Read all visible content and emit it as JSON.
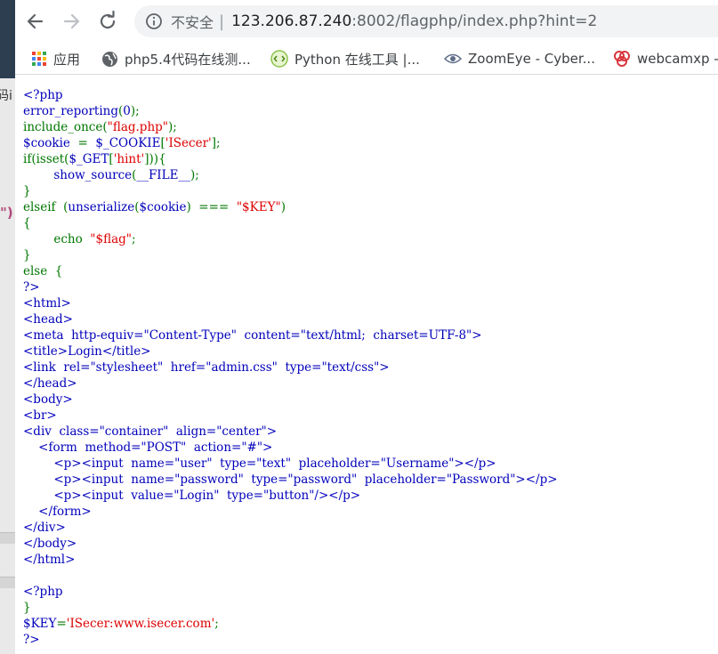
{
  "toolbar": {
    "back_icon": "back-arrow-icon",
    "forward_icon": "forward-arrow-icon",
    "reload_icon": "reload-icon",
    "security_icon": "info-icon",
    "security_label": "不安全",
    "separator": "|",
    "url_host": "123.206.87.240",
    "url_rest": ":8002/flagphp/index.php?hint=2"
  },
  "bookmarks": [
    {
      "icon": "apps-grid-icon",
      "label": "应用"
    },
    {
      "icon": "globe-icon",
      "label": "php5.4代码在线测..."
    },
    {
      "icon": "python-tool-icon",
      "label": "Python 在线工具 |..."
    },
    {
      "icon": "eye-icon",
      "label": "ZoomEye - Cyber..."
    },
    {
      "icon": "webcam-icon",
      "label": "webcamxp -"
    }
  ],
  "left_window": {
    "fragment_text": "码i",
    "quote_fragment": "\")"
  },
  "source_lines": [
    [
      [
        "c-blue",
        "<?php"
      ]
    ],
    [
      [
        "c-blue",
        "error_reporting"
      ],
      [
        "c-green",
        "("
      ],
      [
        "c-blue",
        "0"
      ],
      [
        "c-green",
        ");"
      ]
    ],
    [
      [
        "c-green",
        "include_once("
      ],
      [
        "c-red",
        "\"flag.php\""
      ],
      [
        "c-green",
        ");"
      ]
    ],
    [
      [
        "c-blue",
        "$cookie  "
      ],
      [
        "c-green",
        "=  "
      ],
      [
        "c-blue",
        "$_COOKIE"
      ],
      [
        "c-green",
        "["
      ],
      [
        "c-red",
        "'ISecer'"
      ],
      [
        "c-green",
        "];"
      ]
    ],
    [
      [
        "c-green",
        "if(isset("
      ],
      [
        "c-blue",
        "$_GET"
      ],
      [
        "c-green",
        "["
      ],
      [
        "c-red",
        "'hint'"
      ],
      [
        "c-green",
        "])){"
      ]
    ],
    [
      [
        "c-green",
        "        "
      ],
      [
        "c-blue",
        "show_source"
      ],
      [
        "c-green",
        "("
      ],
      [
        "c-blue",
        "__FILE__"
      ],
      [
        "c-green",
        ");"
      ]
    ],
    [
      [
        "c-green",
        "}"
      ]
    ],
    [
      [
        "c-green",
        "elseif  ("
      ],
      [
        "c-blue",
        "unserialize"
      ],
      [
        "c-green",
        "("
      ],
      [
        "c-blue",
        "$cookie"
      ],
      [
        "c-green",
        ")  ===  "
      ],
      [
        "c-red",
        "\"$KEY\""
      ],
      [
        "c-green",
        ")"
      ]
    ],
    [
      [
        "c-green",
        "{"
      ]
    ],
    [
      [
        "c-green",
        "        echo  "
      ],
      [
        "c-red",
        "\"$flag\""
      ],
      [
        "c-green",
        ";"
      ]
    ],
    [
      [
        "c-green",
        "}"
      ]
    ],
    [
      [
        "c-green",
        "else  {"
      ]
    ],
    [
      [
        "c-blue",
        "?>"
      ]
    ],
    [
      [
        "c-blue",
        "<html>"
      ]
    ],
    [
      [
        "c-blue",
        "<head>"
      ]
    ],
    [
      [
        "c-blue",
        "<meta  http-equiv=\"Content-Type\"  content=\"text/html;  charset=UTF-8\">"
      ]
    ],
    [
      [
        "c-blue",
        "<title>Login</title>"
      ]
    ],
    [
      [
        "c-blue",
        "<link  rel=\"stylesheet\"  href=\"admin.css\"  type=\"text/css\">"
      ]
    ],
    [
      [
        "c-blue",
        "</head>"
      ]
    ],
    [
      [
        "c-blue",
        "<body>"
      ]
    ],
    [
      [
        "c-blue",
        "<br>"
      ]
    ],
    [
      [
        "c-blue",
        "<div  class=\"container\"  align=\"center\">"
      ]
    ],
    [
      [
        "c-blue",
        "    <form  method=\"POST\"  action=\"#\">"
      ]
    ],
    [
      [
        "c-blue",
        "        <p><input  name=\"user\"  type=\"text\"  placeholder=\"Username\"></p>"
      ]
    ],
    [
      [
        "c-blue",
        "        <p><input  name=\"password\"  type=\"password\"  placeholder=\"Password\"></p>"
      ]
    ],
    [
      [
        "c-blue",
        "        <p><input  value=\"Login\"  type=\"button\"/></p>"
      ]
    ],
    [
      [
        "c-blue",
        "    </form>"
      ]
    ],
    [
      [
        "c-blue",
        "</div>"
      ]
    ],
    [
      [
        "c-blue",
        "</body>"
      ]
    ],
    [
      [
        "c-blue",
        "</html>"
      ]
    ],
    [
      [
        "c-blue",
        ""
      ]
    ],
    [
      [
        "c-blue",
        "<?php"
      ]
    ],
    [
      [
        "c-green",
        "}"
      ]
    ],
    [
      [
        "c-blue",
        "$KEY"
      ],
      [
        "c-green",
        "="
      ],
      [
        "c-red",
        "'ISecer:www.isecer.com'"
      ],
      [
        "c-green",
        ";"
      ]
    ],
    [
      [
        "c-blue",
        "?>"
      ]
    ]
  ]
}
